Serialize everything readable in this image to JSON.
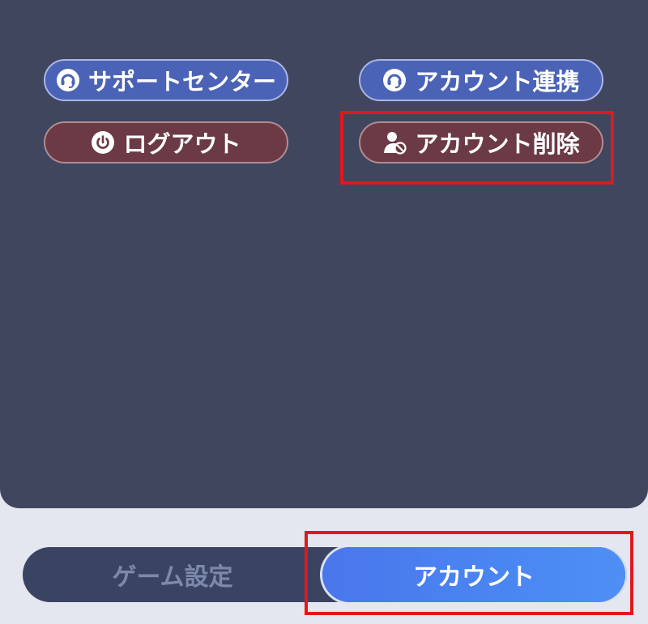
{
  "buttons": {
    "support_center": "サポートセンター",
    "account_link": "アカウント連携",
    "logout": "ログアウト",
    "delete_account": "アカウント削除"
  },
  "tabs": {
    "game_settings": "ゲーム設定",
    "account": "アカウント"
  },
  "colors": {
    "panel": "#3f465e",
    "blue_button": "#4b63b6",
    "red_button": "#6b3a44",
    "active_tab": "#4a7ff0",
    "highlight": "#e0181e"
  },
  "icons": {
    "support_center": "headset-chat-icon",
    "account_link": "headset-chat-icon",
    "logout": "power-icon",
    "delete_account": "user-prohibited-icon"
  }
}
